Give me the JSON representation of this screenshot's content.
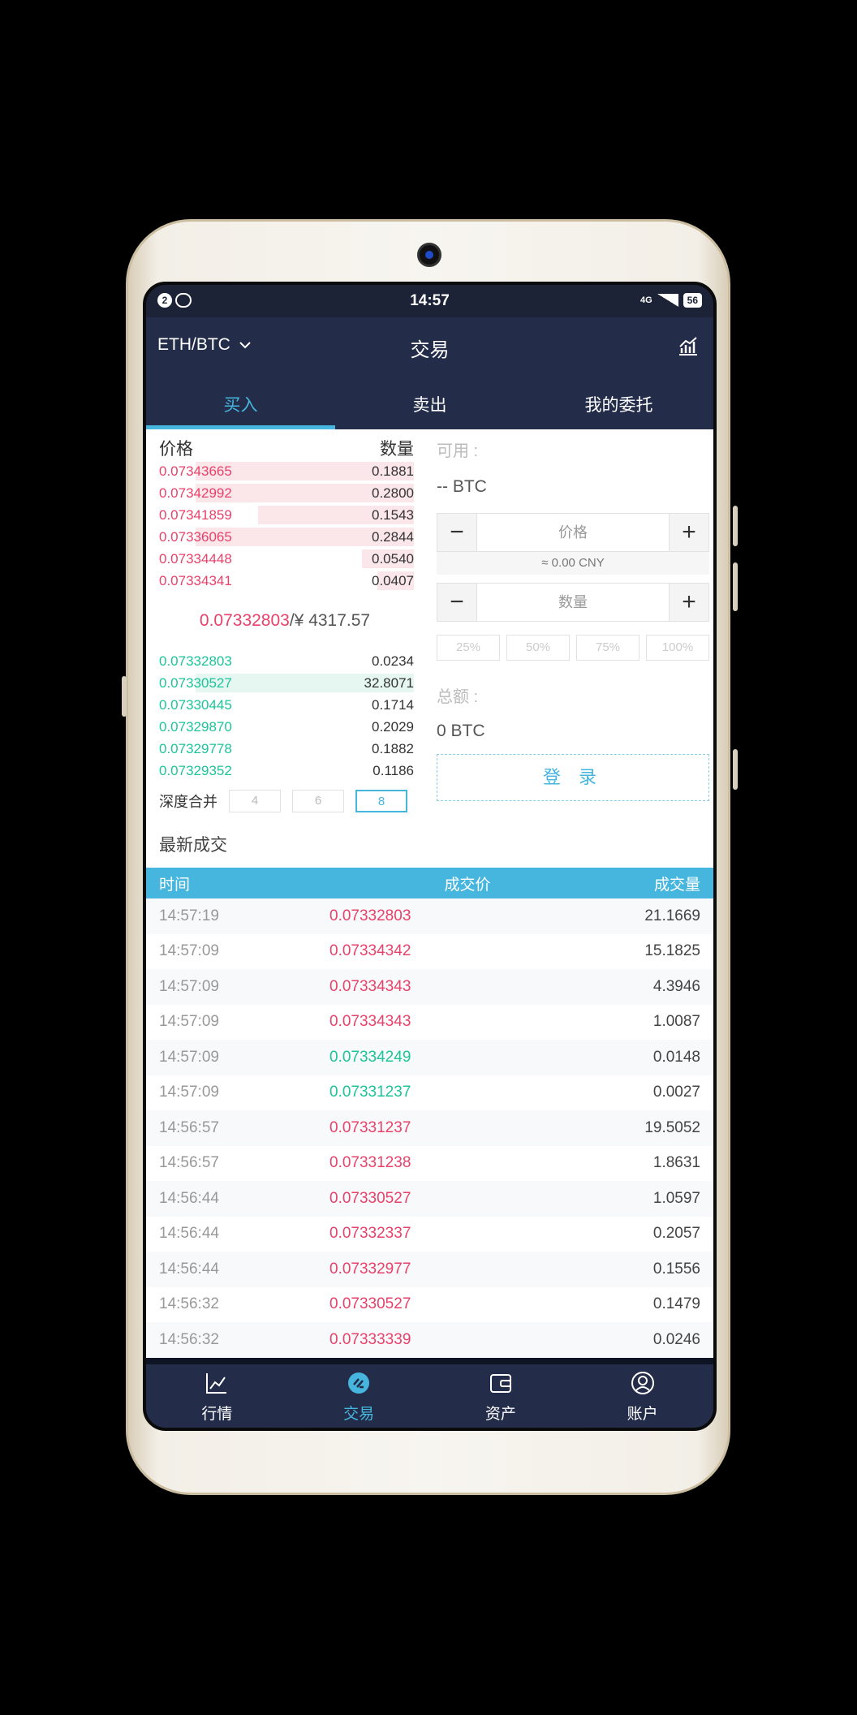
{
  "status": {
    "time": "14:57",
    "notif_count": "2",
    "network": "4G",
    "battery": "56"
  },
  "header": {
    "pair": "ETH/BTC",
    "title": "交易"
  },
  "tabs": [
    "买入",
    "卖出",
    "我的委托"
  ],
  "orderbook": {
    "col_price": "价格",
    "col_qty": "数量",
    "asks": [
      {
        "price": "0.07343665",
        "qty": "0.1881",
        "depth": 0.84
      },
      {
        "price": "0.07342992",
        "qty": "0.2800",
        "depth": 0.84
      },
      {
        "price": "0.07341859",
        "qty": "0.1543",
        "depth": 0.6
      },
      {
        "price": "0.07336065",
        "qty": "0.2844",
        "depth": 0.84
      },
      {
        "price": "0.07334448",
        "qty": "0.0540",
        "depth": 0.2
      },
      {
        "price": "0.07334341",
        "qty": "0.0407",
        "depth": 0.14
      }
    ],
    "mid_price": "0.07332803",
    "mid_cny": "/¥ 4317.57",
    "bids": [
      {
        "price": "0.07332803",
        "qty": "0.0234",
        "depth": 0.0
      },
      {
        "price": "0.07330527",
        "qty": "32.8071",
        "depth": 0.84
      },
      {
        "price": "0.07330445",
        "qty": "0.1714",
        "depth": 0.0
      },
      {
        "price": "0.07329870",
        "qty": "0.2029",
        "depth": 0.0
      },
      {
        "price": "0.07329778",
        "qty": "0.1882",
        "depth": 0.0
      },
      {
        "price": "0.07329352",
        "qty": "0.1186",
        "depth": 0.0
      }
    ],
    "depth_label": "深度合并",
    "depth_options": [
      "4",
      "6",
      "8"
    ],
    "depth_selected": "8"
  },
  "form": {
    "available_label": "可用 :",
    "available_value": "-- BTC",
    "price_placeholder": "价格",
    "cny_estimate": "≈ 0.00 CNY",
    "qty_placeholder": "数量",
    "percents": [
      "25%",
      "50%",
      "75%",
      "100%"
    ],
    "total_label": "总额 :",
    "total_value": "0 BTC",
    "login_label": "登 录"
  },
  "latest": {
    "title": "最新成交",
    "col_time": "时间",
    "col_price": "成交价",
    "col_qty": "成交量",
    "rows": [
      {
        "time": "14:57:19",
        "price": "0.07332803",
        "qty": "21.1669",
        "side": "sell"
      },
      {
        "time": "14:57:09",
        "price": "0.07334342",
        "qty": "15.1825",
        "side": "sell"
      },
      {
        "time": "14:57:09",
        "price": "0.07334343",
        "qty": "4.3946",
        "side": "sell"
      },
      {
        "time": "14:57:09",
        "price": "0.07334343",
        "qty": "1.0087",
        "side": "sell"
      },
      {
        "time": "14:57:09",
        "price": "0.07334249",
        "qty": "0.0148",
        "side": "buy"
      },
      {
        "time": "14:57:09",
        "price": "0.07331237",
        "qty": "0.0027",
        "side": "buy"
      },
      {
        "time": "14:56:57",
        "price": "0.07331237",
        "qty": "19.5052",
        "side": "sell"
      },
      {
        "time": "14:56:57",
        "price": "0.07331238",
        "qty": "1.8631",
        "side": "sell"
      },
      {
        "time": "14:56:44",
        "price": "0.07330527",
        "qty": "1.0597",
        "side": "sell"
      },
      {
        "time": "14:56:44",
        "price": "0.07332337",
        "qty": "0.2057",
        "side": "sell"
      },
      {
        "time": "14:56:44",
        "price": "0.07332977",
        "qty": "0.1556",
        "side": "sell"
      },
      {
        "time": "14:56:32",
        "price": "0.07330527",
        "qty": "0.1479",
        "side": "sell"
      },
      {
        "time": "14:56:32",
        "price": "0.07333339",
        "qty": "0.0246",
        "side": "sell"
      }
    ]
  },
  "nav": [
    {
      "label": "行情",
      "icon": "chart-line-icon"
    },
    {
      "label": "交易",
      "icon": "trade-icon"
    },
    {
      "label": "资产",
      "icon": "wallet-icon"
    },
    {
      "label": "账户",
      "icon": "user-icon"
    }
  ],
  "colors": {
    "accent": "#46b6de",
    "sell": "#e8416a",
    "buy": "#1cc49a",
    "nav_bg": "#232c48"
  }
}
